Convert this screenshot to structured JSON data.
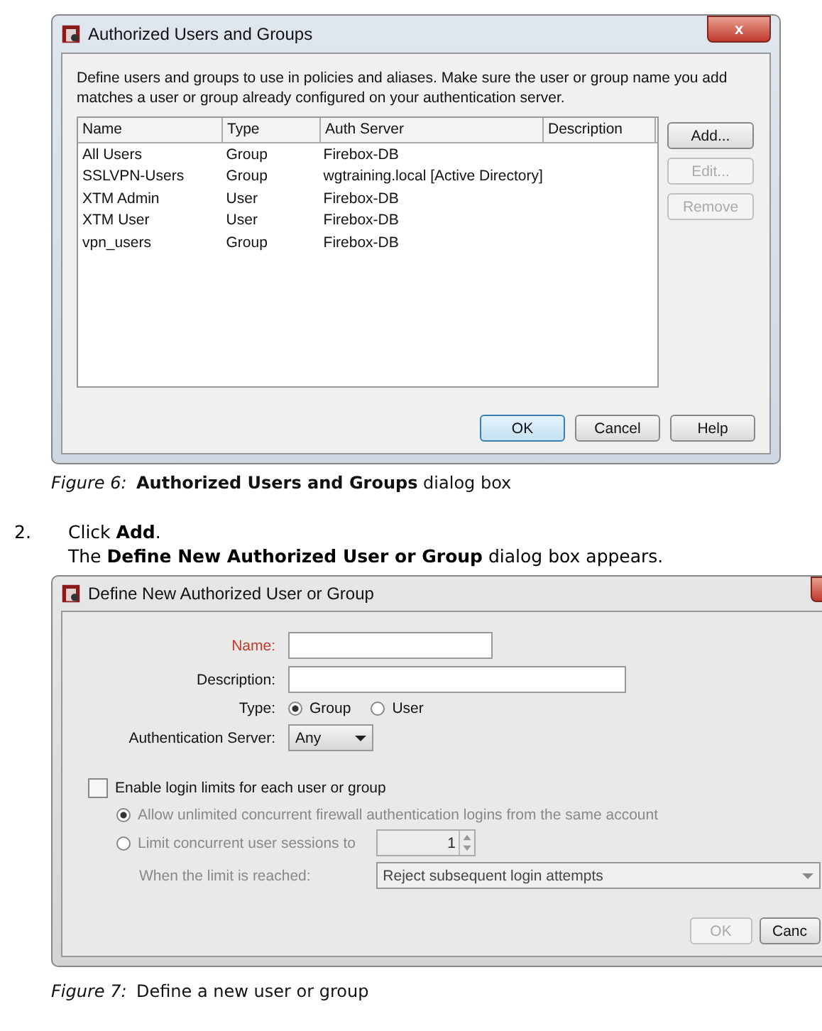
{
  "figure_1": {
    "dialog": {
      "title": "Authorized Users and Groups",
      "close": "x",
      "description": "Define users and groups to use in policies and aliases. Make sure the user or group name you add matches a user or group already configured on your authentication server.",
      "table": {
        "columns": [
          "Name",
          "Type",
          "Auth Server",
          "Description"
        ],
        "rows": [
          [
            "All Users",
            "Group",
            "Firebox-DB"
          ],
          [
            "SSLVPN-Users",
            "Group",
            "wgtraining.local [Active Directory]"
          ],
          [
            "XTM Admin",
            "User",
            "Firebox-DB"
          ],
          [
            "XTM User",
            "User",
            "Firebox-DB"
          ],
          [
            "vpn_users",
            "Group",
            "Firebox-DB"
          ]
        ]
      },
      "side_buttons": [
        {
          "label": "Add...",
          "disabled": false
        },
        {
          "label": "Edit...",
          "disabled": true
        },
        {
          "label": "Remove",
          "disabled": true
        }
      ],
      "buttons": [
        {
          "label": "OK",
          "default": true
        },
        {
          "label": "Cancel",
          "default": false
        },
        {
          "label": "Help",
          "default": false
        }
      ]
    },
    "caption": {
      "label": "Figure 6:",
      "text": "**Authorized Users and Groups** dialog box"
    }
  },
  "step": {
    "number": "2.",
    "text": "Click **Add**.",
    "result": "The **Define New Authorized User or Group** dialog box appears."
  },
  "figure_2": {
    "dialog": {
      "title": "Define New Authorized User or Group",
      "name": {
        "label": "Name:",
        "required": true
      },
      "description": {
        "label": "Description:"
      },
      "type": {
        "label": "Type:",
        "options": [
          {
            "label": "Group",
            "selected": true
          },
          {
            "label": "User",
            "selected": false
          }
        ]
      },
      "auth_server": {
        "label": "Authentication Server:",
        "value": "Any"
      },
      "login_limits": {
        "label": "Enable login limits for each user or group",
        "checked": false,
        "options": [
          {
            "label": "Allow unlimited concurrent firewall authentication logins from the same account",
            "selected": true
          },
          {
            "label": "Limit concurrent user sessions to",
            "selected": false
          }
        ],
        "sessions": "1",
        "when_label": "When the limit is reached:",
        "when_value": "Reject subsequent login attempts"
      },
      "buttons": [
        {
          "label": "OK",
          "disabled": true
        },
        {
          "label": "Canc",
          "disabled": false
        }
      ]
    },
    "caption": {
      "label": "Figure 7:",
      "text": "Define a new user or group"
    }
  }
}
